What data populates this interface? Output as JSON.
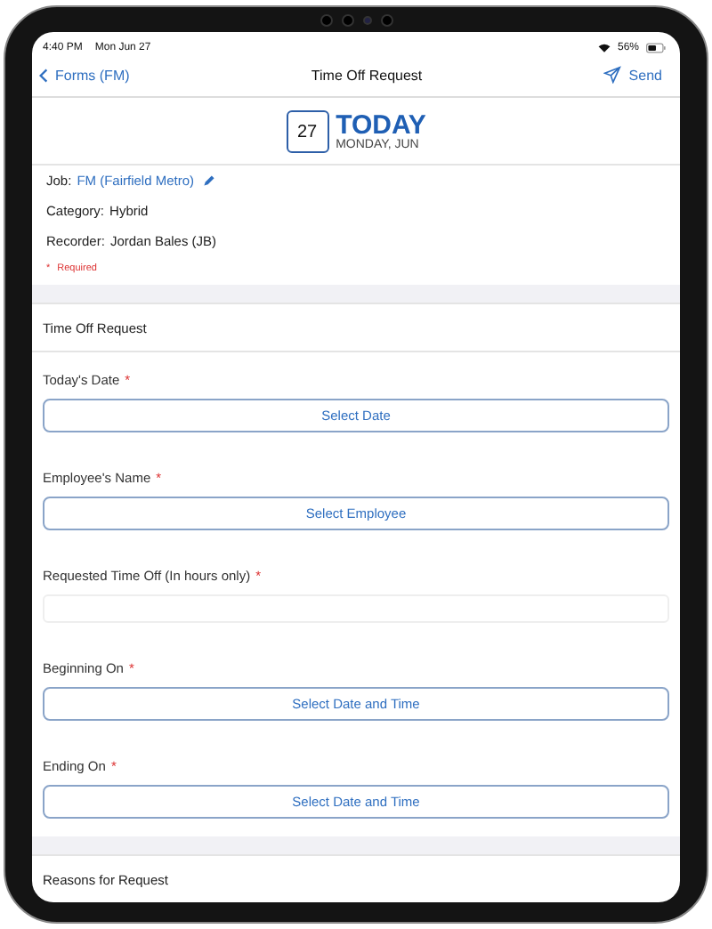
{
  "status_bar": {
    "time": "4:40 PM",
    "date": "Mon Jun 27",
    "battery": "56%"
  },
  "nav": {
    "back": "Forms (FM)",
    "title": "Time Off Request",
    "action": "Send"
  },
  "today": {
    "day": "27",
    "title": "TODAY",
    "subtitle": "MONDAY, JUN"
  },
  "info": [
    {
      "label": "Job:",
      "value": "FM (Fairfield Metro)",
      "kind": "link"
    },
    {
      "label": "Category:",
      "value": "Hybrid",
      "kind": "text"
    },
    {
      "label": "Recorder:",
      "value": "Jordan Bales (JB)",
      "kind": "text"
    }
  ],
  "required_note": {
    "mark": "*",
    "text": "Required"
  },
  "section": "Time Off Request",
  "fields": [
    {
      "label": "Today's Date",
      "mark": "*",
      "kind": "button",
      "text": "Select Date"
    },
    {
      "label": "Employee's Name",
      "mark": "*",
      "kind": "button",
      "text": "Select Employee"
    },
    {
      "label": "Requested Time Off (In hours only)",
      "mark": "*",
      "kind": "input"
    },
    {
      "label": "Beginning On",
      "mark": "*",
      "kind": "button",
      "text": "Select Date and Time"
    },
    {
      "label": "Ending On",
      "mark": "*",
      "kind": "button",
      "text": "Select Date and Time"
    }
  ],
  "next_section": "Reasons for Request"
}
